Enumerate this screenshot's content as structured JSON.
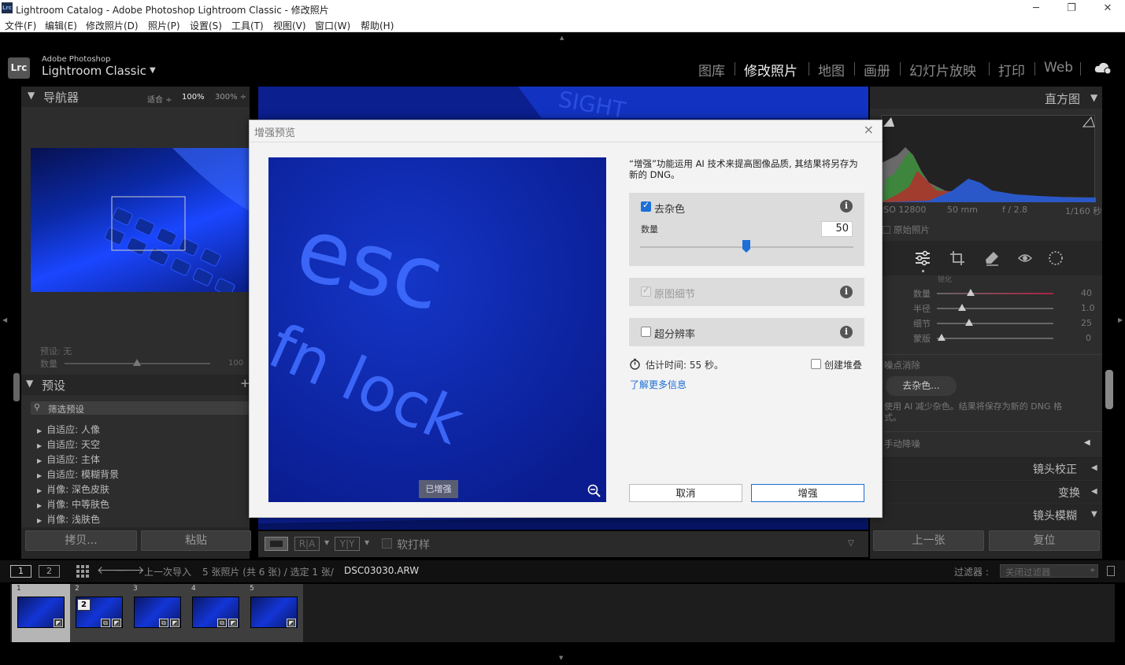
{
  "window": {
    "title": "Lightroom Catalog - Adobe Photoshop Lightroom Classic - 修改照片",
    "app_icon": "Lrc"
  },
  "menu": [
    "文件(F)",
    "编辑(E)",
    "修改照片(D)",
    "照片(P)",
    "设置(S)",
    "工具(T)",
    "视图(V)",
    "窗口(W)",
    "帮助(H)"
  ],
  "brand": {
    "logo": "Lrc",
    "small": "Adobe Photoshop",
    "big": "Lightroom Classic",
    "arrow": "▼"
  },
  "modules": [
    "图库",
    "修改照片",
    "地图",
    "画册",
    "幻灯片放映",
    "打印",
    "Web"
  ],
  "active_module": "修改照片",
  "navigator": {
    "title": "导航器",
    "zoom_fit": "适合 ÷",
    "zoom_100": "100%",
    "zoom_300": "300% ÷"
  },
  "preset_amount": {
    "label_preset": "预设: 无",
    "label_amount": "数量",
    "value": "100"
  },
  "presets": {
    "title": "预设",
    "add": "+",
    "filter_placeholder": "筛选预设",
    "items": [
      "自适应: 人像",
      "自适应: 天空",
      "自适应: 主体",
      "自适应: 模糊背景",
      "肖像: 深色皮肤",
      "肖像: 中等肤色",
      "肖像: 浅肤色"
    ]
  },
  "left_buttons": {
    "copy": "拷贝...",
    "paste": "粘贴"
  },
  "histogram": {
    "title": "直方图",
    "iso": "ISO 12800",
    "focal": "50 mm",
    "aperture": "f / 2.8",
    "shutter": "1/160 秒",
    "original": "原始照片"
  },
  "sharpen": {
    "partial_header": "锐化",
    "rows": [
      {
        "label": "数量",
        "value": "40",
        "level": 0.3
      },
      {
        "label": "半径",
        "value": "1.0",
        "level": 0.22
      },
      {
        "label": "细节",
        "value": "25",
        "level": 0.28
      },
      {
        "label": "蒙版",
        "value": "0",
        "level": 0.0
      }
    ]
  },
  "noise": {
    "header": "噪点消除",
    "denoise_button": "去杂色...",
    "desc": "使用 AI 减少杂色。结果将保存为新的 DNG 格式。",
    "manual": "手动降噪"
  },
  "right_sections": [
    {
      "label": "镜头校正",
      "arrow": "◀"
    },
    {
      "label": "变换",
      "arrow": "◀"
    },
    {
      "label": "镜头模糊",
      "arrow": "▼"
    }
  ],
  "right_buttons": {
    "prev": "上一张",
    "reset": "复位"
  },
  "toolbar": {
    "softproof": "软打样"
  },
  "filmbar": {
    "view1": "1",
    "view2": "2",
    "source": "上一次导入",
    "count": "5 张照片 (共 6 张) / 选定 1 张/",
    "filename": "DSC03030.ARW",
    "filter_label": "过滤器 :",
    "filter_value": "关闭过滤器"
  },
  "thumbnails": [
    {
      "num": "1",
      "selected": true,
      "badge": ""
    },
    {
      "num": "2",
      "selected": false,
      "badge": "2"
    },
    {
      "num": "3",
      "selected": false,
      "badge": ""
    },
    {
      "num": "4",
      "selected": false,
      "badge": ""
    },
    {
      "num": "5",
      "selected": false,
      "badge": ""
    }
  ],
  "dialog": {
    "title": "增强预览",
    "close": "×",
    "preview_text_1": "esc",
    "preview_text_2": "fn lock",
    "enhanced_badge": "已增强",
    "description": "“增强”功能运用 AI 技术来提高图像品质, 其结果将另存为新的 DNG。",
    "denoise": {
      "label": "去杂色",
      "checked": true,
      "amount_label": "数量",
      "amount": "50",
      "level": 0.5
    },
    "raw_details": {
      "label": "原图细节",
      "checked": true,
      "disabled": true
    },
    "super_res": {
      "label": "超分辨率",
      "checked": false
    },
    "estimate": "估计时间: 55 秒。",
    "create_stack": "创建堆叠",
    "learn_more": "了解更多信息",
    "cancel": "取消",
    "enhance": "增强"
  },
  "colors": {
    "accent": "#1c6fd6",
    "panel": "#2d2d2d",
    "image_blue": "#0a1f8c"
  }
}
